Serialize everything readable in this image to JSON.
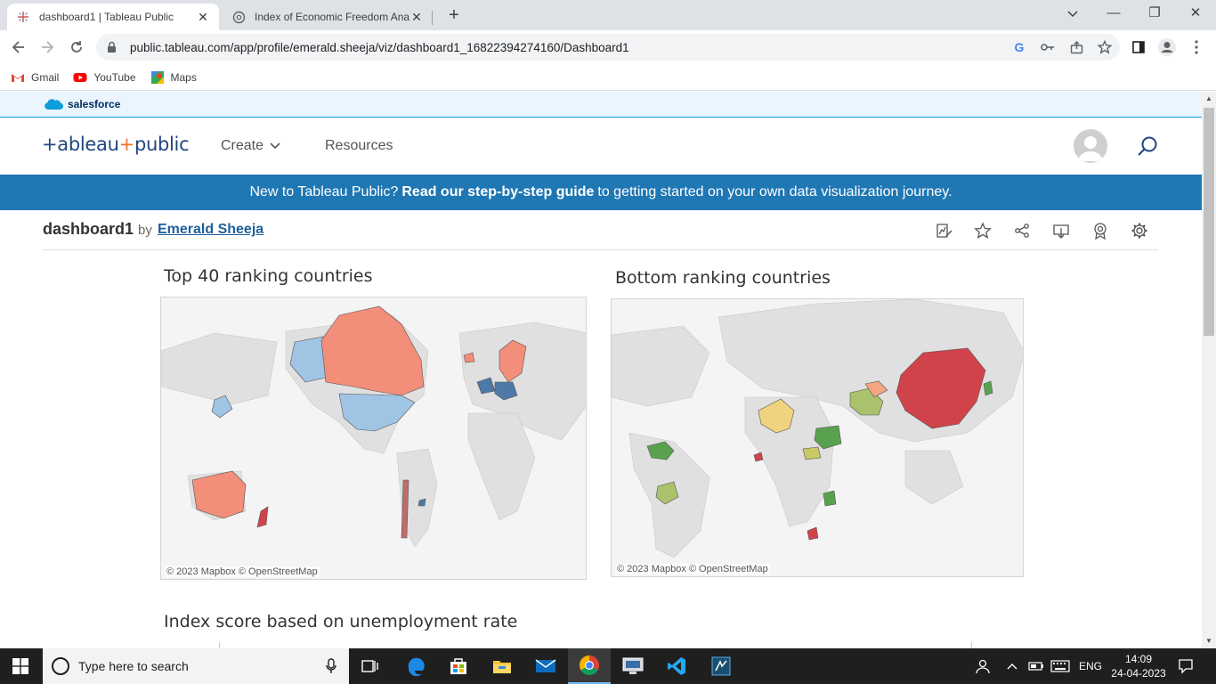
{
  "browser": {
    "tabs": [
      {
        "title": "dashboard1 | Tableau Public",
        "close": "✕"
      },
      {
        "title": "Index of Economic Freedom Anal",
        "close": "✕"
      }
    ],
    "new_tab": "+",
    "window_controls": {
      "minimize": "—",
      "maximize": "❐",
      "close": "✕"
    },
    "url": "public.tableau.com/app/profile/emerald.sheeja/viz/dashboard1_16822394274160/Dashboard1",
    "bookmarks": [
      {
        "label": "Gmail"
      },
      {
        "label": "YouTube"
      },
      {
        "label": "Maps"
      }
    ]
  },
  "salesforce_bar": {
    "label": "salesforce"
  },
  "header": {
    "logo_left": "+ableau",
    "logo_plus": "+",
    "logo_right": "public",
    "nav": [
      {
        "label": "Create"
      },
      {
        "label": "Resources"
      }
    ]
  },
  "banner": {
    "prefix": "New to Tableau Public?",
    "link": "Read our step-by-step guide",
    "suffix": "to getting started on your own data visualization journey."
  },
  "viz": {
    "name": "dashboard1",
    "by": "by",
    "author": "Emerald Sheeja"
  },
  "dashboard": {
    "top_title": "Top 40 ranking countries",
    "bottom_title": "Bottom ranking countries",
    "map_credit": "© 2023 Mapbox  © OpenStreetMap",
    "third_title": "Index score based on unemployment rate"
  },
  "taskbar": {
    "search_placeholder": "Type here to search",
    "language": "ENG",
    "time": "14:09",
    "date": "24-04-2023"
  },
  "colors": {
    "tableau_blue": "#1f77b4",
    "salmon": "#f28e79",
    "steel_blue": "#a0c4e4",
    "red": "#d1434a",
    "green": "#59a14f",
    "yellow": "#f1d37f"
  }
}
